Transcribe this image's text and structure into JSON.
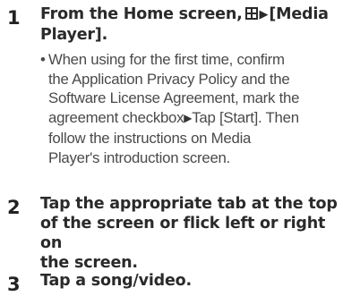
{
  "steps": [
    {
      "number": "1",
      "title_before_icon": "From the Home screen,",
      "icon": "grid-menu-icon",
      "arrow": "▶",
      "title_after_icon": "[Media",
      "title_line2": "Player].",
      "note": {
        "bullet": "•",
        "lines": [
          "When using for the first time, confirm",
          "the Application Privacy Policy and the",
          "Software License Agreement, mark the",
          "agreement checkbox",
          "Tap [Start]. Then",
          "follow the instructions on Media",
          "Player's introduction screen."
        ],
        "arrow": "▶"
      }
    },
    {
      "number": "2",
      "title_lines": [
        "Tap the appropriate tab at the top",
        "of the screen or flick left or right on",
        "the screen."
      ]
    },
    {
      "number": "3",
      "title_lines": [
        "Tap a song/video."
      ]
    }
  ]
}
